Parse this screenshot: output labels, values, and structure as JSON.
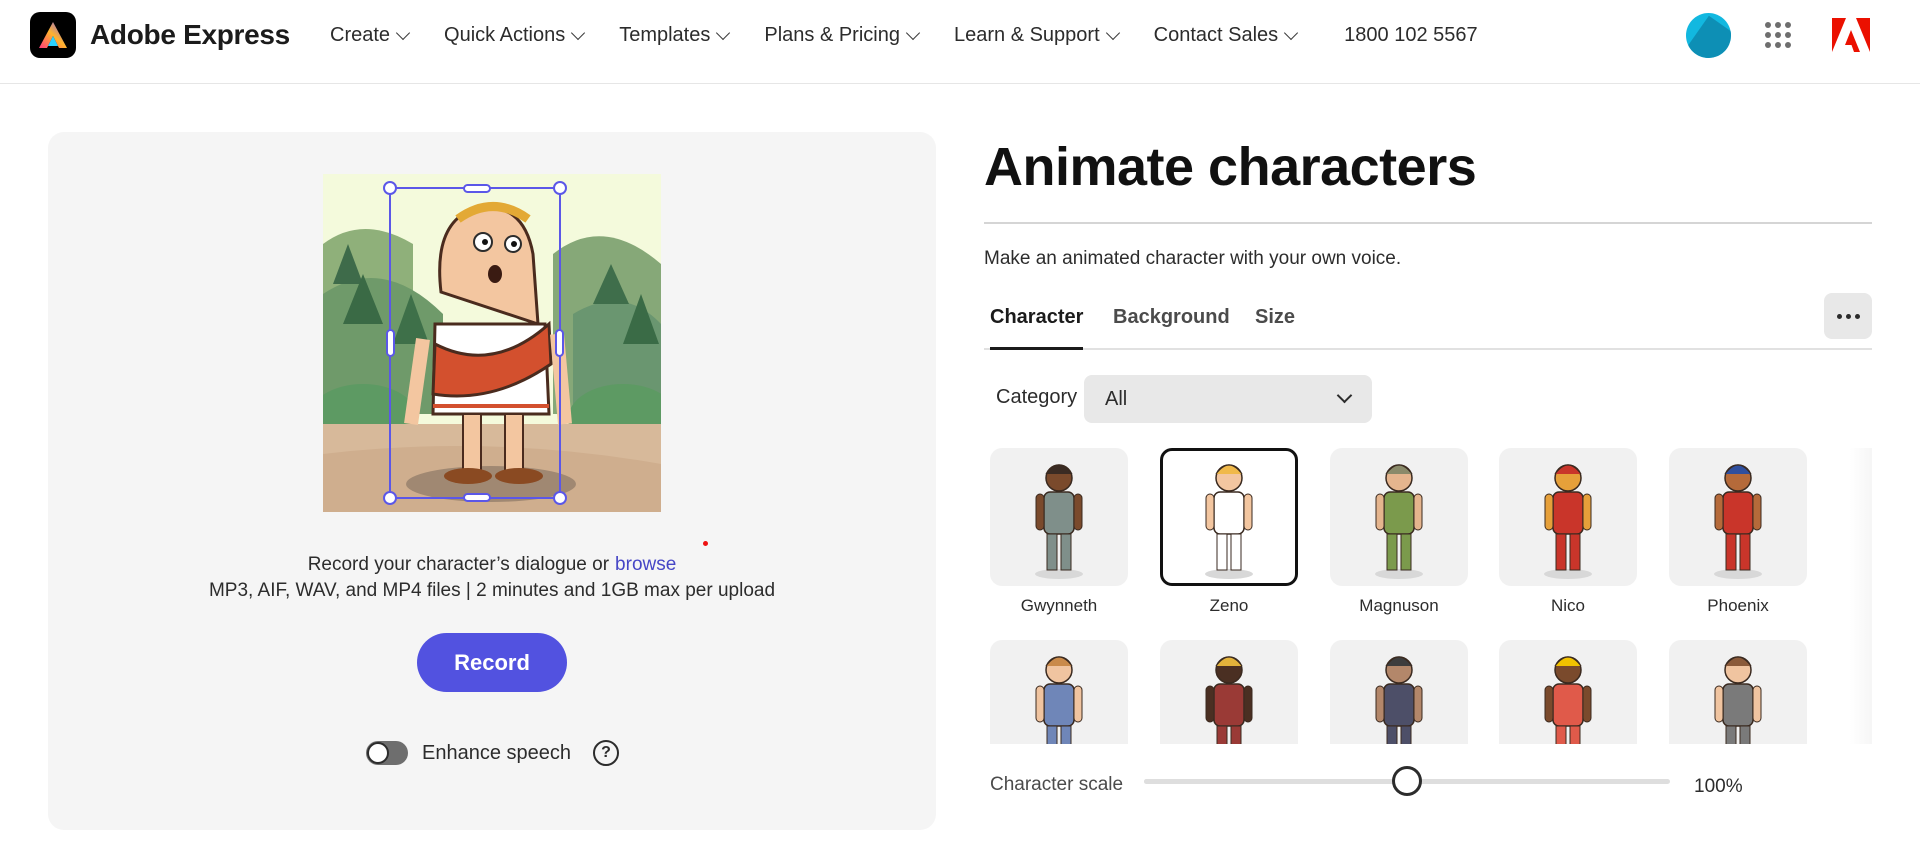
{
  "header": {
    "brand": "Adobe Express",
    "nav": [
      {
        "label": "Create"
      },
      {
        "label": "Quick Actions"
      },
      {
        "label": "Templates"
      },
      {
        "label": "Plans & Pricing"
      },
      {
        "label": "Learn & Support"
      },
      {
        "label": "Contact Sales"
      }
    ],
    "phone": "1800 102 5567",
    "icons": {
      "apps": "apps-grid-icon",
      "adobe": "adobe-logo-icon",
      "avatar": "user-avatar"
    }
  },
  "editor": {
    "record_prompt": "Record your character’s dialogue or",
    "browse_link": "browse",
    "file_info": "MP3, AIF, WAV, and MP4 files | 2 minutes and 1GB max per upload",
    "record_button": "Record",
    "enhance_label": "Enhance speech",
    "enhance_enabled": false,
    "help_glyph": "?"
  },
  "panel": {
    "title": "Animate characters",
    "subtitle": "Make an animated character with your own voice.",
    "tabs": [
      {
        "label": "Character",
        "active": true
      },
      {
        "label": "Background",
        "active": false
      },
      {
        "label": "Size",
        "active": false
      }
    ],
    "category_label": "Category",
    "category_value": "All",
    "characters": [
      {
        "name": "Gwynneth",
        "skin": "#7a4a2c",
        "outfit": "#7f8f8a",
        "hair": "#3a2b23",
        "selected": false
      },
      {
        "name": "Zeno",
        "skin": "#f3c6a0",
        "outfit": "#ffffff",
        "hair": "#f0b94a",
        "selected": true
      },
      {
        "name": "Magnuson",
        "skin": "#e5b58e",
        "outfit": "#7b9a4c",
        "hair": "#8a8a6a",
        "selected": false
      },
      {
        "name": "Nico",
        "skin": "#e6a03a",
        "outfit": "#c9352a",
        "hair": "#c9352a",
        "selected": false
      },
      {
        "name": "Phoenix",
        "skin": "#b56a3a",
        "outfit": "#c9352a",
        "hair": "#2f4f9e",
        "selected": false
      },
      {
        "name": "",
        "skin": "#f0c4a0",
        "outfit": "#6f86b8",
        "hair": "#c98a4a",
        "selected": false
      },
      {
        "name": "",
        "skin": "#4a2f22",
        "outfit": "#9a3a36",
        "hair": "#e2b23b",
        "selected": false
      },
      {
        "name": "",
        "skin": "#b3876a",
        "outfit": "#4d4f68",
        "hair": "#3d3d3d",
        "selected": false
      },
      {
        "name": "",
        "skin": "#7a4a2c",
        "outfit": "#e05a4a",
        "hair": "#f2c200",
        "selected": false
      },
      {
        "name": "",
        "skin": "#f0c4a0",
        "outfit": "#7a7a7a",
        "hair": "#8a5a3a",
        "selected": false
      }
    ],
    "scale_label": "Character scale",
    "scale_value_text": "100%",
    "scale_level": 0.5
  },
  "colors": {
    "accent": "#5252e0",
    "link": "#4646c6",
    "selection": "#5b57e8",
    "panel_bg": "#f5f5f5"
  }
}
